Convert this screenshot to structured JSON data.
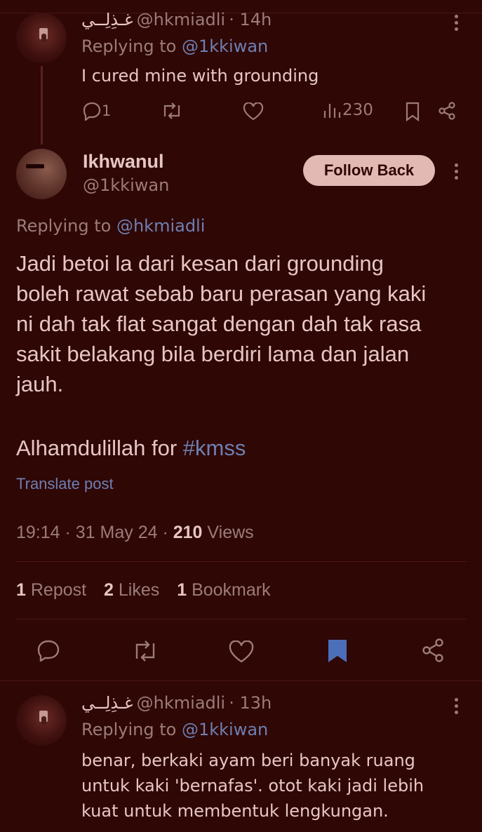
{
  "reply1": {
    "name": "غـذِلِــي",
    "handle": "@hkmiadli",
    "time": "· 14h",
    "replying_prefix": "Replying to",
    "replying_to": "@1kkiwan",
    "text": "I cured mine with grounding",
    "reply_count": "1",
    "views": "230"
  },
  "main": {
    "name": "Ikhwanul",
    "handle": "@1kkiwan",
    "follow_label": "Follow Back",
    "replying_prefix": "Replying to",
    "replying_to": "@hkmiadli",
    "text_lines": [
      "Jadi betoi la dari kesan dari grounding",
      "boleh rawat sebab baru perasan yang kaki",
      "ni dah tak flat sangat dengan dah tak rasa",
      "sakit belakang bila berdiri lama dan jalan",
      "jauh."
    ],
    "text2_prefix": "Alhamdulillah for",
    "hashtag": "#kmss",
    "translate": "Translate post",
    "timestamp": "19:14 · 31 May 24 ·",
    "views_count": "210",
    "views_label": "Views",
    "reposts_count": "1",
    "reposts_label": "Repost",
    "likes_count": "2",
    "likes_label": "Likes",
    "bookmarks_count": "1",
    "bookmarks_label": "Bookmark"
  },
  "reply2": {
    "name": "غـذِلِــي",
    "handle": "@hkmiadli",
    "time": "· 13h",
    "replying_prefix": "Replying to",
    "replying_to": "@1kkiwan",
    "text_lines": [
      "benar, berkaki ayam beri banyak ruang",
      "untuk kaki 'bernafas'. otot kaki jadi lebih",
      "kuat untuk membentuk lengkungan."
    ]
  },
  "colors": {
    "background": "#2f0705",
    "text": "#e6c6c4",
    "muted": "#9b7c79",
    "link": "#6f7fb2",
    "bookmark_active": "#4b6fb8",
    "follow_button": "#e3b9b4"
  },
  "icons": [
    "reply-icon",
    "repost-icon",
    "like-icon",
    "views-icon",
    "bookmark-icon",
    "share-icon",
    "more-icon"
  ]
}
